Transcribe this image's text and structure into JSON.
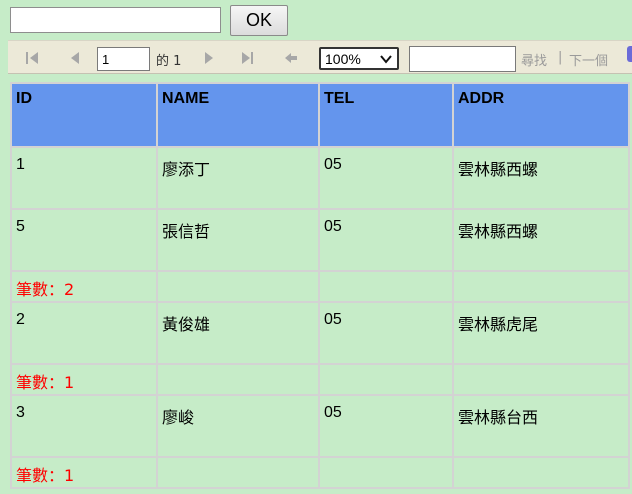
{
  "top": {
    "input_value": "",
    "ok_label": "OK"
  },
  "toolbar": {
    "page_value": "1",
    "of_label": "的 1",
    "zoom_value": "100%",
    "find_value": "",
    "find_label": "尋找",
    "separator": "|",
    "next_label": "下一個",
    "icons": [
      "first-page-icon",
      "prev-page-icon",
      "next-page-icon",
      "last-page-icon",
      "back-icon",
      "chevron-down-icon"
    ]
  },
  "table": {
    "headers": [
      "ID",
      "NAME",
      "TEL",
      "ADDR"
    ],
    "rows": [
      {
        "type": "data",
        "cells": [
          "1",
          "廖添丁",
          "05",
          "雲林縣西螺"
        ]
      },
      {
        "type": "data",
        "cells": [
          "5",
          "張信哲",
          "05",
          "雲林縣西螺"
        ]
      },
      {
        "type": "count",
        "cells": [
          "筆數：2",
          "",
          "",
          ""
        ]
      },
      {
        "type": "data",
        "cells": [
          "2",
          "黃俊雄",
          "05",
          "雲林縣虎尾"
        ]
      },
      {
        "type": "count",
        "cells": [
          "筆數：1",
          "",
          "",
          ""
        ]
      },
      {
        "type": "data",
        "cells": [
          "3",
          "廖峻",
          "05",
          "雲林縣台西"
        ]
      },
      {
        "type": "count",
        "cells": [
          "筆數：1",
          "",
          "",
          ""
        ]
      }
    ]
  },
  "colors": {
    "background": "#c6ecc8",
    "header": "#6495ed",
    "count_text": "#ff0000",
    "toolbar": "#ece9d8"
  }
}
